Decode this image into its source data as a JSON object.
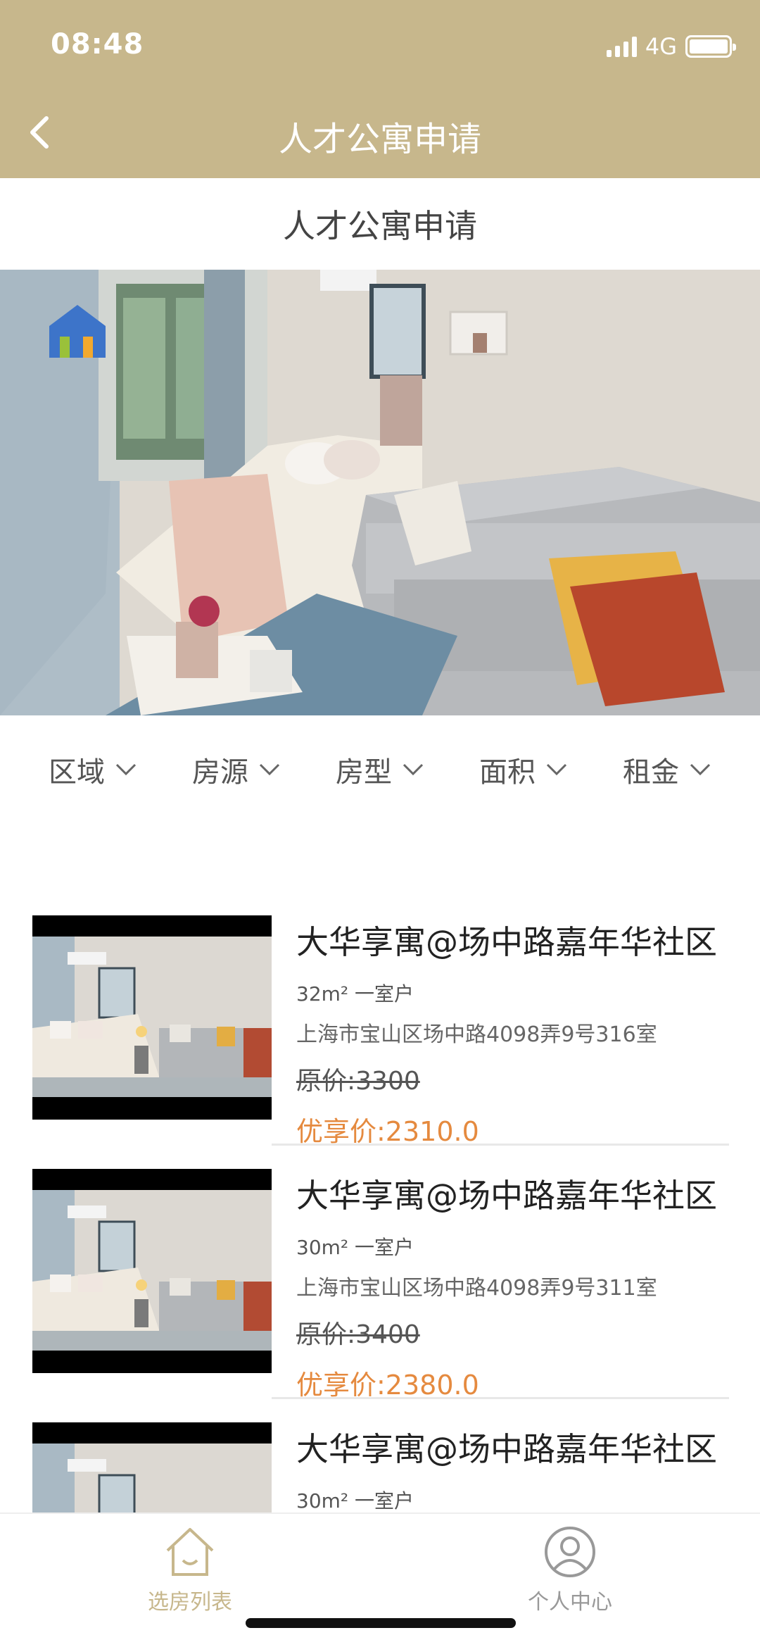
{
  "status_bar": {
    "time": "08:48",
    "network": "4G"
  },
  "nav": {
    "title": "人才公寓申请"
  },
  "page_heading": "人才公寓申请",
  "filters": [
    "区域",
    "房源",
    "房型",
    "面积",
    "租金"
  ],
  "listings": [
    {
      "title": "大华享寓@场中路嘉年华社区",
      "spec": "32m² 一室户",
      "address": "上海市宝山区场中路4098弄9号316室",
      "original_price": "原价:3300",
      "sale_price": "优享价:2310.0"
    },
    {
      "title": "大华享寓@场中路嘉年华社区",
      "spec": "30m² 一室户",
      "address": "上海市宝山区场中路4098弄9号311室",
      "original_price": "原价:3400",
      "sale_price": "优享价:2380.0"
    },
    {
      "title": "大华享寓@场中路嘉年华社区",
      "spec": "30m² 一室户"
    }
  ],
  "tabs": [
    {
      "label": "选房列表",
      "icon": "home-icon",
      "active": true
    },
    {
      "label": "个人中心",
      "icon": "user-icon",
      "active": false
    }
  ],
  "colors": {
    "header": "#c7b78c",
    "accent_price": "#e58a3f",
    "tab_active": "#c7b78c",
    "tab_inactive": "#999999"
  }
}
